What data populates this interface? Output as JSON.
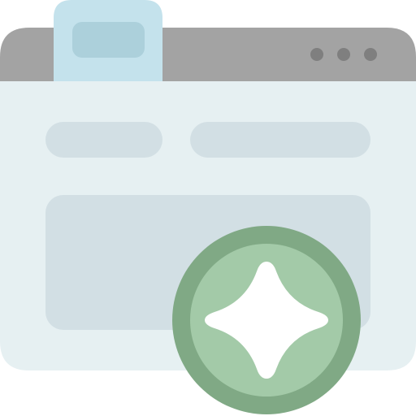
{
  "illustration": {
    "subject": "browser-window-with-sparkle-badge",
    "colors": {
      "window_body": "#e6f0f2",
      "title_bar": "#a3a3a3",
      "window_dots": "#7f7f7f",
      "tab": "#c4e2ec",
      "tab_inner": "#acd0db",
      "placeholder_bars": "#d2dfe4",
      "content_panel": "#d2dfe4",
      "badge_ring": "#80a985",
      "badge_fill": "#a3caa8",
      "sparkle": "#ffffff"
    },
    "icons": [
      "browser-window-icon",
      "sparkle-icon"
    ]
  }
}
